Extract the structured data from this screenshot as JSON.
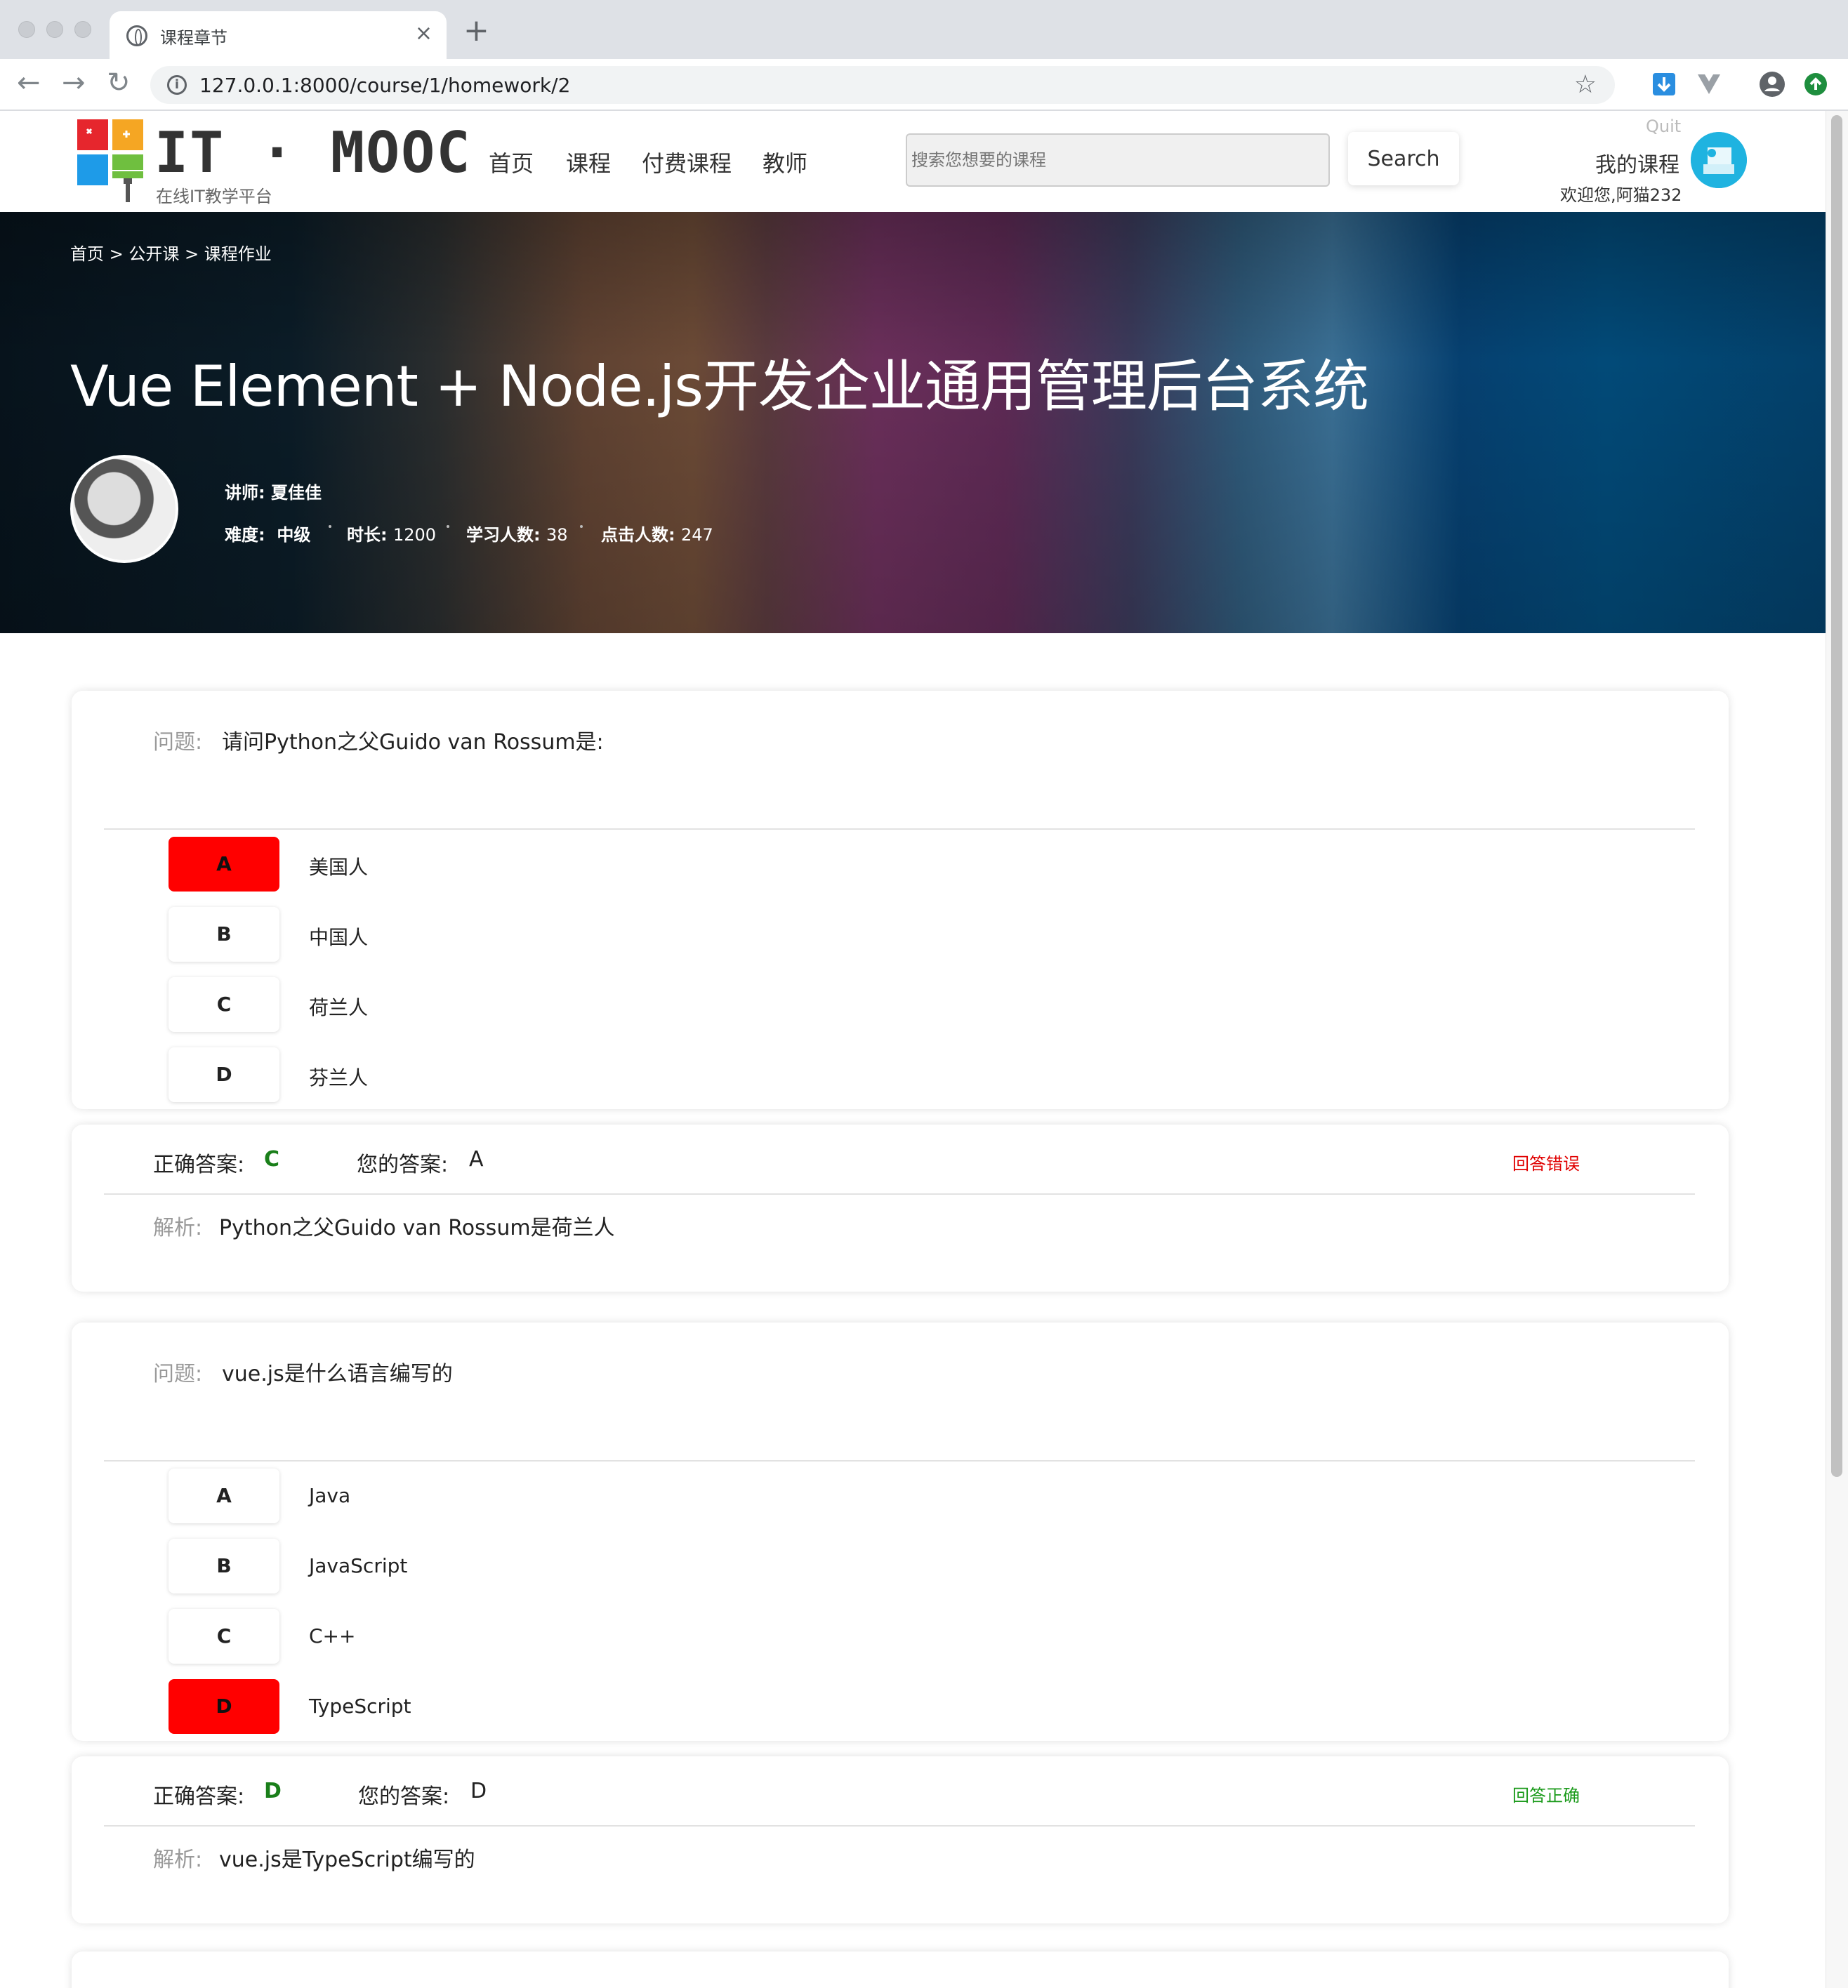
{
  "browser": {
    "tab_title": "课程章节",
    "close_glyph": "×",
    "newtab_glyph": "+",
    "back_glyph": "←",
    "forward_glyph": "→",
    "reload_glyph": "↻",
    "info_glyph": "i",
    "star_glyph": "☆",
    "url": "127.0.0.1:8000/course/1/homework/2"
  },
  "header": {
    "logo_text": "IT · MOOC",
    "logo_sub": "在线IT教学平台",
    "nav": [
      "首页",
      "课程",
      "付费课程",
      "教师"
    ],
    "search_placeholder": "搜索您想要的课程",
    "search_button": "Search",
    "quit": "Quit",
    "my_courses": "我的课程",
    "welcome": "欢迎您,阿猫232"
  },
  "banner": {
    "breadcrumb": "首页 > 公开课 > 课程作业",
    "title": "Vue Element + Node.js开发企业通用管理后台系统",
    "teacher_label": "讲师:",
    "teacher_name": "夏佳佳",
    "difficulty_label": "难度:",
    "difficulty": "中级",
    "duration_label": "时长:",
    "duration": "1200",
    "learners_label": "学习人数:",
    "learners": "38",
    "clicks_label": "点击人数:",
    "clicks": "247"
  },
  "labels": {
    "question": "问题:",
    "correct_answer": "正确答案:",
    "your_answer": "您的答案:",
    "analysis": "解析:"
  },
  "questions": [
    {
      "text": "请问Python之父Guido van Rossum是:",
      "options": [
        {
          "key": "A",
          "text": "美国人"
        },
        {
          "key": "B",
          "text": "中国人"
        },
        {
          "key": "C",
          "text": "荷兰人"
        },
        {
          "key": "D",
          "text": "芬兰人"
        }
      ],
      "selected": "A",
      "correct": "C",
      "answer": "A",
      "status": "回答错误",
      "status_color": "#e00000",
      "analysis": "Python之父Guido van Rossum是荷兰人"
    },
    {
      "text": "vue.js是什么语言编写的",
      "options": [
        {
          "key": "A",
          "text": "Java"
        },
        {
          "key": "B",
          "text": "JavaScript"
        },
        {
          "key": "C",
          "text": "C++"
        },
        {
          "key": "D",
          "text": "TypeScript"
        }
      ],
      "selected": "D",
      "correct": "D",
      "answer": "D",
      "status": "回答正确",
      "status_color": "#1a9a1a",
      "analysis": "vue.js是TypeScript编写的"
    }
  ],
  "colors": {
    "selected_option": "#ff0000",
    "correct_answer": "#1a7f1a",
    "avatar_accent": "#1fb3e0"
  }
}
